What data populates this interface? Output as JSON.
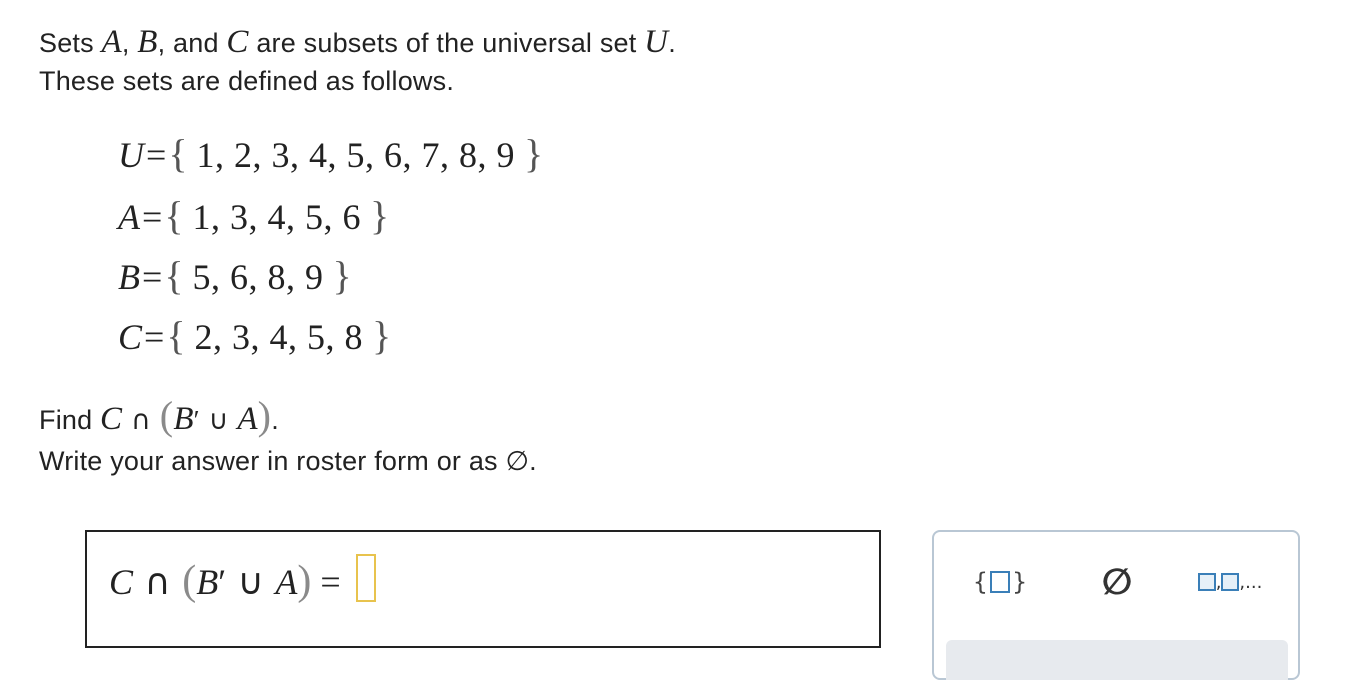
{
  "problem": {
    "intro_line1": {
      "p1": "Sets ",
      "A": "A",
      "comma1": ", ",
      "B": "B",
      "comma2": ", and ",
      "C": "C",
      "p2": " are subsets of the universal set ",
      "U": "U",
      "end": "."
    },
    "intro_line2": "These sets are defined as follows.",
    "sets": [
      {
        "name": "U",
        "elements": "1, 2, 3, 4, 5, 6, 7, 8, 9"
      },
      {
        "name": "A",
        "elements": "1, 3, 4, 5, 6"
      },
      {
        "name": "B",
        "elements": "5, 6, 8, 9"
      },
      {
        "name": "C",
        "elements": "2, 3, 4, 5, 8"
      }
    ],
    "find": {
      "prefix": "Find ",
      "C": "C",
      "intersect": " ∩ ",
      "open": "(",
      "B": "B",
      "prime": "′",
      "union": " ∪ ",
      "A": "A",
      "close": ")",
      "end": "."
    },
    "instruction": {
      "text": "Write your answer in roster form or as ",
      "empty_symbol": "∅",
      "end": "."
    },
    "symbols": {
      "equals": "=",
      "open_brace": "{",
      "close_brace": "}"
    }
  },
  "answer": {
    "C": "C",
    "intersect": " ∩ ",
    "open": "(",
    "B": "B",
    "prime": "′",
    "union": " ∪ ",
    "A": "A",
    "close": ")",
    "equals": " = ",
    "value": ""
  },
  "palette": {
    "braces_open": "{",
    "braces_close": "}",
    "empty_set": "∅",
    "list_comma": ",",
    "list_ellipsis": ",..."
  },
  "colors": {
    "answer_slot_border": "#e8c34d",
    "palette_border": "#b9c7d4",
    "icon_accent": "#3a7fb8"
  }
}
